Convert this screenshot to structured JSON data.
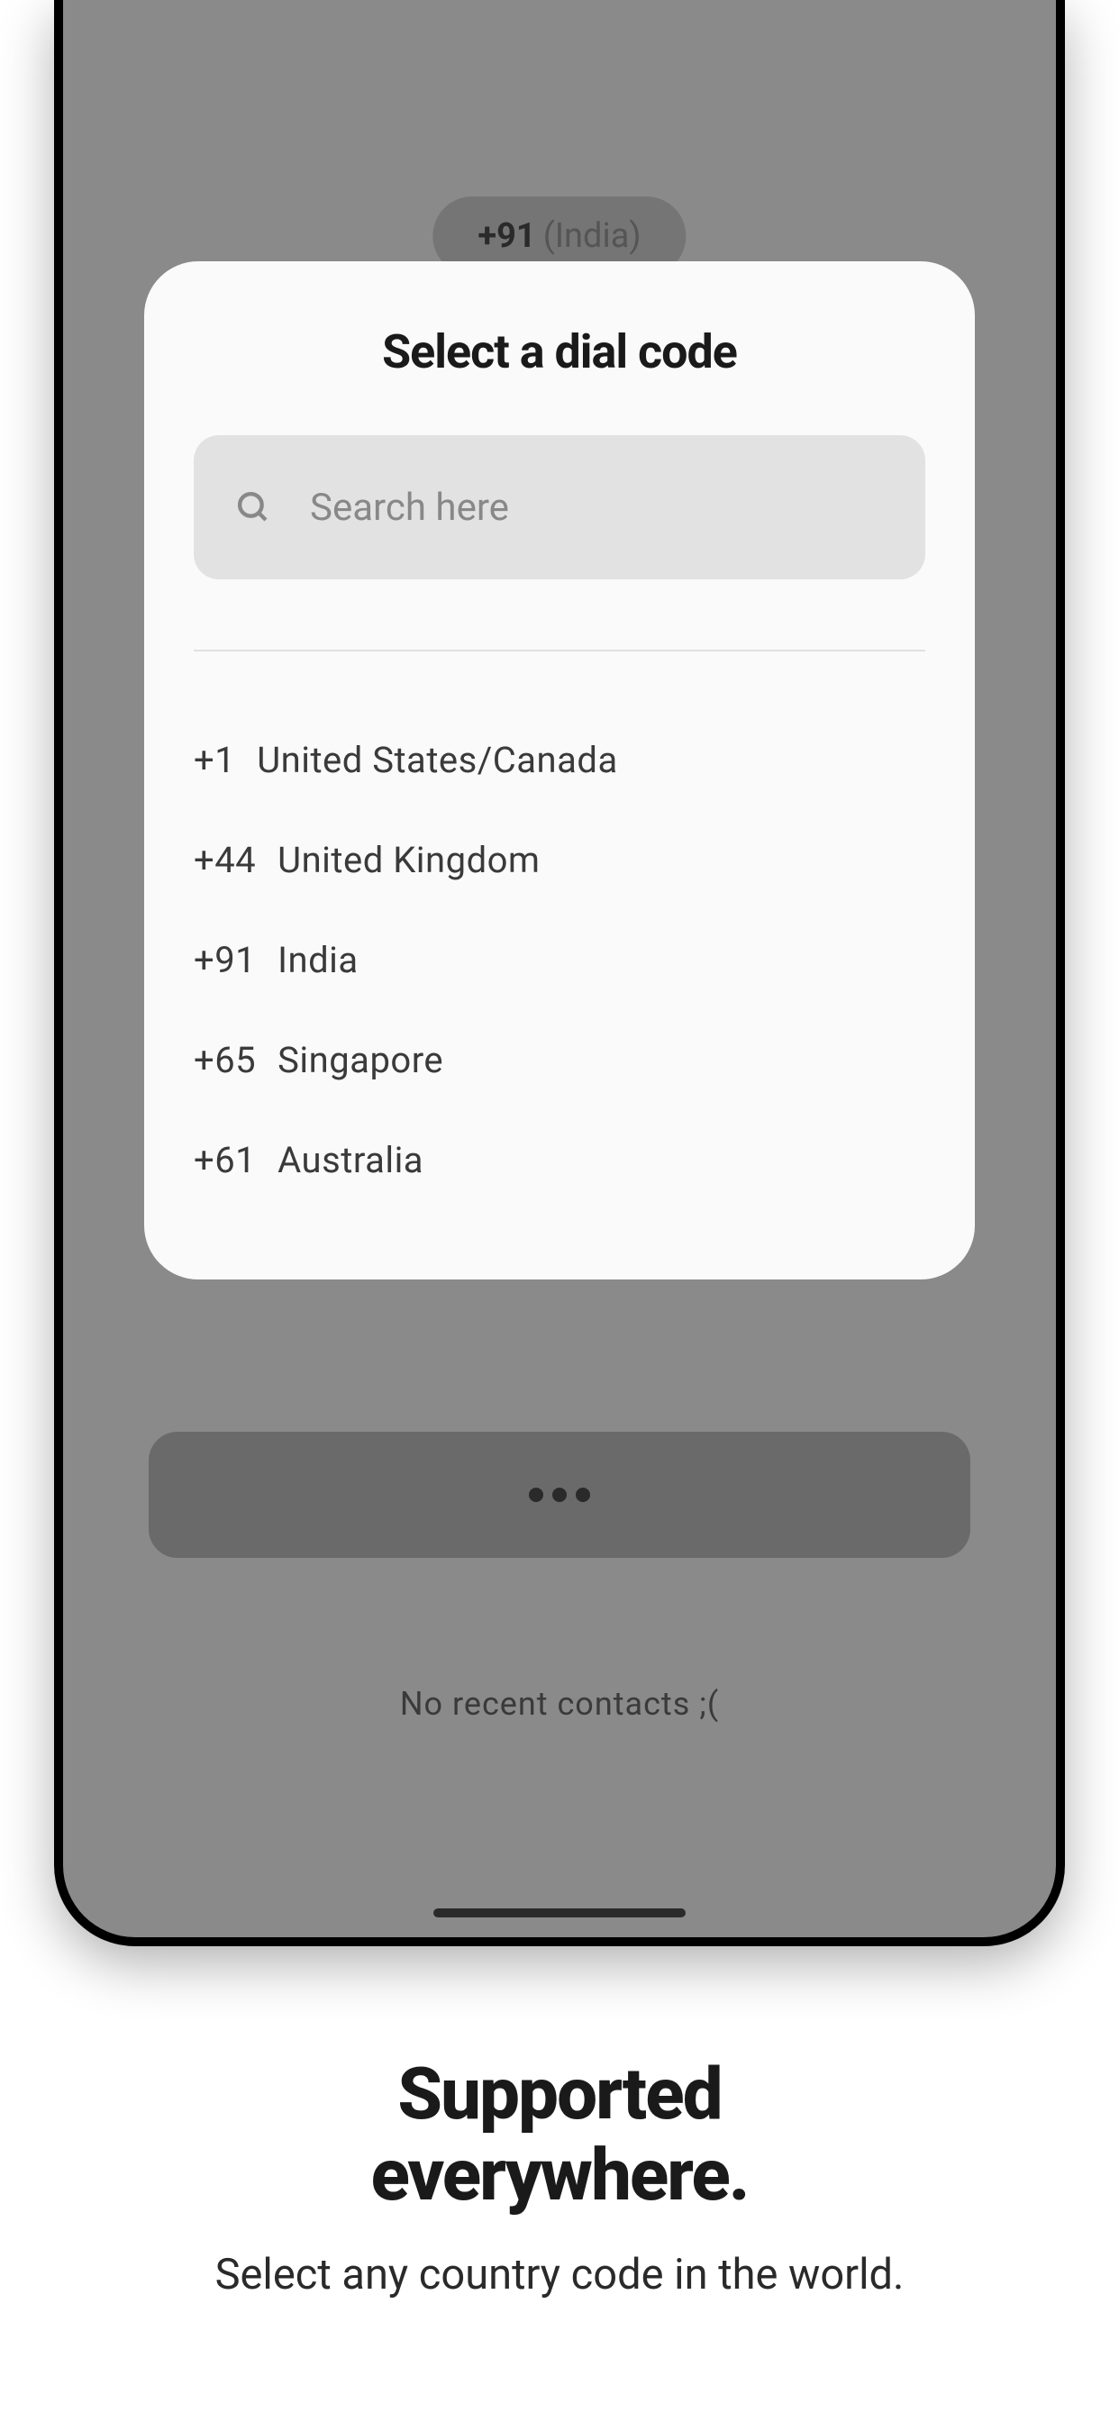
{
  "background": {
    "selected_code": "+91",
    "selected_country": "(India)",
    "no_contacts": "No recent contacts ;("
  },
  "modal": {
    "title": "Select a dial code",
    "search_placeholder": "Search here",
    "countries": [
      {
        "code": "+1",
        "name": "United States/Canada"
      },
      {
        "code": "+44",
        "name": "United Kingdom"
      },
      {
        "code": "+91",
        "name": "India"
      },
      {
        "code": "+65",
        "name": "Singapore"
      },
      {
        "code": "+61",
        "name": "Australia"
      }
    ]
  },
  "marketing": {
    "title_line1": "Supported",
    "title_line2": "everywhere.",
    "subtitle": "Select any country code in the world."
  }
}
